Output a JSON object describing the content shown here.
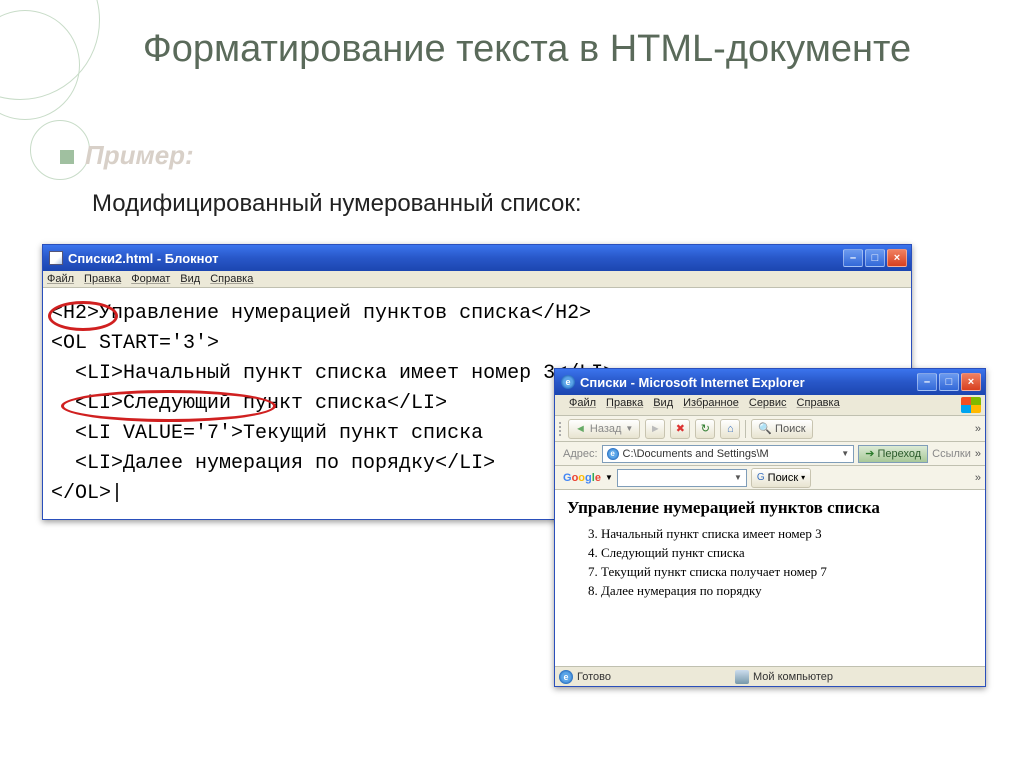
{
  "slide": {
    "title": "Форматирование текста в HTML-документе",
    "example_label": "Пример:",
    "body": "Модифицированный нумерованный список:"
  },
  "notepad": {
    "title": "Списки2.html - Блокнот",
    "menu": {
      "file": "Файл",
      "edit": "Правка",
      "format": "Формат",
      "view": "Вид",
      "help": "Справка"
    },
    "lines": {
      "l1": "<H2>Управление нумерацией пунктов списка</H2>",
      "l2": "<OL START='3'>",
      "l3": "  <LI>Начальный пункт списка имеет номер 3</LI>",
      "l4": "  <LI>Следующий пункт списка</LI>",
      "l5": "  <LI VALUE='7'>Текущий пункт списка",
      "l6": "  <LI>Далее нумерация по порядку</LI>",
      "l7": "</OL>|"
    }
  },
  "ie": {
    "title": "Списки - Microsoft Internet Explorer",
    "menu": {
      "file": "Файл",
      "edit": "Правка",
      "view": "Вид",
      "fav": "Избранное",
      "tools": "Сервис",
      "help": "Справка"
    },
    "toolbar": {
      "back": "Назад",
      "search": "Поиск"
    },
    "address": {
      "label": "Адрес:",
      "value": "C:\\Documents and Settings\\М",
      "go": "Переход",
      "links": "Ссылки"
    },
    "google": {
      "logo": "Google",
      "search": "Поиск"
    },
    "content": {
      "heading": "Управление нумерацией пунктов списка",
      "items": {
        "i3": "Начальный пункт списка имеет номер 3",
        "i4": "Следующий пункт списка",
        "i7": "Текущий пункт списка получает номер 7",
        "i8": "Далее нумерация по порядку"
      }
    },
    "status": {
      "ready": "Готово",
      "mycomputer": "Мой компьютер"
    }
  }
}
